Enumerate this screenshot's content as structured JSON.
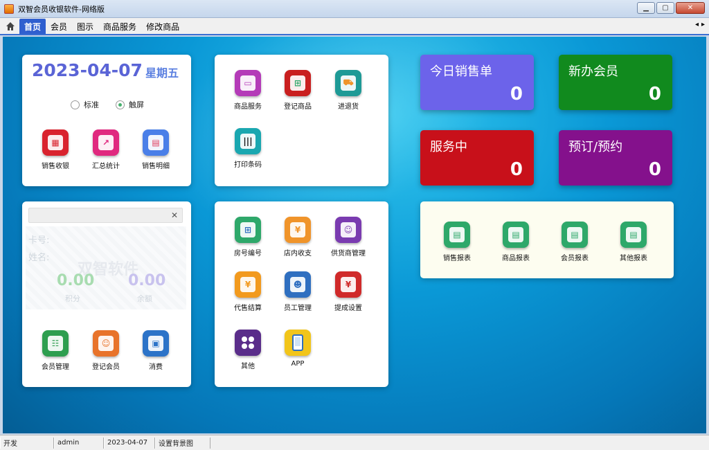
{
  "window": {
    "title": "双智会员收银软件-网络版"
  },
  "menu": {
    "items": [
      "首页",
      "会员",
      "图示",
      "商品服务",
      "修改商品"
    ],
    "active": 0
  },
  "date_card": {
    "date": "2023-04-07",
    "weekday": "星期五",
    "mode_options": [
      "标准",
      "触屏"
    ],
    "mode_selected": "触屏",
    "tiles": [
      {
        "label": "销售收银",
        "icon": "cashier-icon",
        "color": "#d9232e"
      },
      {
        "label": "汇总统计",
        "icon": "chart-icon",
        "color": "#e0297f"
      },
      {
        "label": "销售明细",
        "icon": "document-icon",
        "color": "#4a7fe8"
      }
    ]
  },
  "goods_card": {
    "tiles": [
      {
        "label": "商品服务",
        "icon": "service-icon",
        "color": "#b43bb8"
      },
      {
        "label": "登记商品",
        "icon": "basket-icon",
        "color": "#c91f1f"
      },
      {
        "label": "进退货",
        "icon": "truck-icon",
        "color": "#1e9a96"
      },
      {
        "label": "打印条码",
        "icon": "barcode-icon",
        "color": "#1aa7b0"
      }
    ]
  },
  "member_card": {
    "card_no_label": "卡号:",
    "name_label": "姓名:",
    "watermark": "双智软件",
    "points_value": "0.00",
    "points_label": "积分",
    "balance_value": "0.00",
    "balance_label": "余额",
    "tiles": [
      {
        "label": "会员管理",
        "icon": "member-manage-icon",
        "color": "#2e9e4f"
      },
      {
        "label": "登记会员",
        "icon": "register-member-icon",
        "color": "#e8732a"
      },
      {
        "label": "消费",
        "icon": "consume-icon",
        "color": "#2c73c8"
      }
    ]
  },
  "functions_card": {
    "tiles": [
      {
        "label": "房号编号",
        "icon": "room-icon",
        "color": "#2ea86a"
      },
      {
        "label": "店内收支",
        "icon": "money-icon",
        "color": "#f0942a"
      },
      {
        "label": "供货商管理",
        "icon": "supplier-icon",
        "color": "#7a3bb0"
      },
      {
        "label": "代售结算",
        "icon": "settle-icon",
        "color": "#f29a1e"
      },
      {
        "label": "员工管理",
        "icon": "staff-icon",
        "color": "#2f6fc0"
      },
      {
        "label": "提成设置",
        "icon": "commission-icon",
        "color": "#d02a2a"
      },
      {
        "label": "其他",
        "icon": "grid-icon",
        "color": "#5a2d8a"
      },
      {
        "label": "APP",
        "icon": "phone-icon",
        "color": "#f2c51a"
      }
    ]
  },
  "stats": [
    {
      "label": "今日销售单",
      "value": "0",
      "color": "#6c63ea"
    },
    {
      "label": "新办会员",
      "value": "0",
      "color": "#118a1e"
    },
    {
      "label": "服务中",
      "value": "0",
      "color": "#c8101a"
    },
    {
      "label": "预订/预约",
      "value": "0",
      "color": "#84118c"
    }
  ],
  "reports": {
    "tiles": [
      {
        "label": "销售报表",
        "icon": "report-icon",
        "color": "#2ea86a"
      },
      {
        "label": "商品报表",
        "icon": "report-icon",
        "color": "#2ea86a"
      },
      {
        "label": "会员报表",
        "icon": "report-icon",
        "color": "#2ea86a"
      },
      {
        "label": "其他报表",
        "icon": "report-icon",
        "color": "#2ea86a"
      }
    ]
  },
  "statusbar": {
    "cells": [
      "开发",
      "admin",
      "2023-04-07",
      "设置背景图"
    ]
  }
}
